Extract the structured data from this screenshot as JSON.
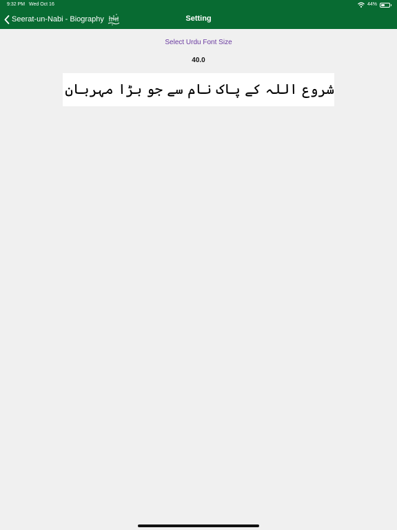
{
  "status_bar": {
    "time": "9:32 PM",
    "date": "Wed Oct 16",
    "battery_percent": "44%",
    "battery_level": 0.44,
    "icons": [
      "wifi-icon",
      "battery-icon"
    ]
  },
  "nav": {
    "back_label": "Seerat-un-Nabi - Biography",
    "title": "Setting",
    "back_icon": "chevron-left-icon",
    "logo_icon": "calligraphy-icon"
  },
  "settings": {
    "select_label": "Select Urdu Font Size",
    "font_size_value": "40.0",
    "preview_text": "شروع اللہ کے پاک نام سے جو بڑا مہربان نہایت رحم والا ہے"
  },
  "colors": {
    "header": "#086b32",
    "accent": "#6a3aa0",
    "background": "#f0f0f0"
  }
}
